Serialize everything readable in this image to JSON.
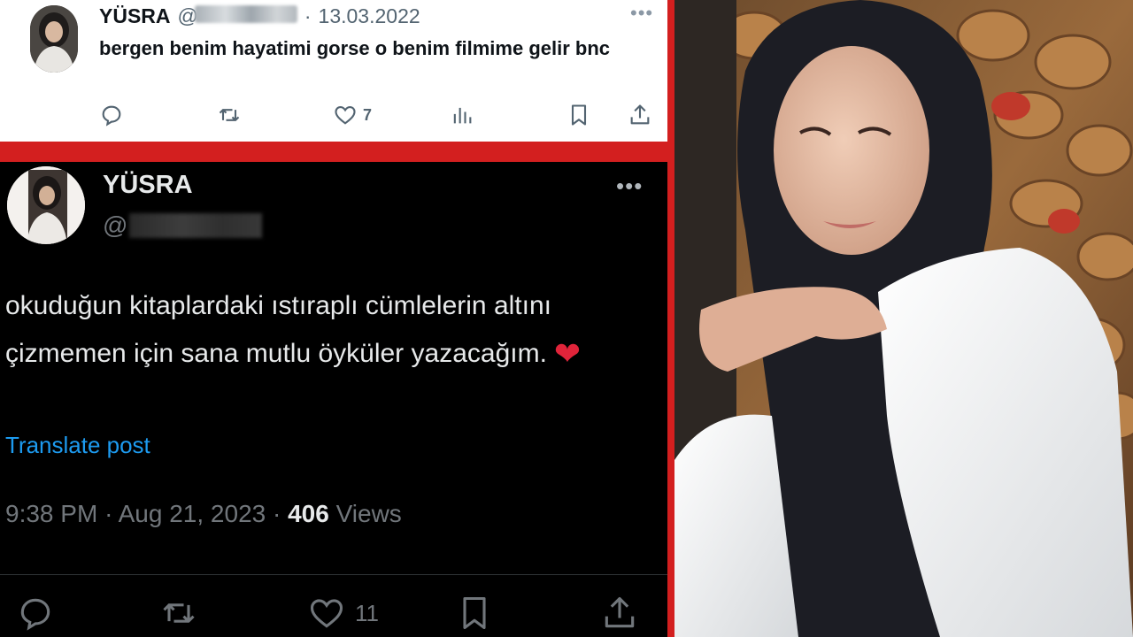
{
  "light_tweet": {
    "name": "YÜSRA",
    "handle_prefix": "@",
    "separator": "·",
    "date": "13.03.2022",
    "text": "bergen benim hayatimi gorse o benim filmime gelir bnc",
    "like_count": "7",
    "icons": [
      "reply-icon",
      "retweet-icon",
      "like-icon",
      "views-icon",
      "bookmark-icon",
      "share-icon"
    ]
  },
  "dark_tweet": {
    "name": "YÜSRA",
    "handle_prefix": "@",
    "text_before_heart": "okuduğun kitaplardaki ıstıraplı cümlelerin altını çizmemen için sana mutlu öyküler yazacağım.",
    "heart": "❤",
    "translate_label": "Translate post",
    "time": "9:38 PM",
    "separator": "·",
    "date": "Aug 21, 2023",
    "views_count": "406",
    "views_label": "Views",
    "like_count": "11",
    "icons": [
      "reply-icon",
      "retweet-icon",
      "like-icon",
      "bookmark-icon",
      "share-icon"
    ]
  },
  "colors": {
    "frame_red": "#d31f1f",
    "link_blue": "#1d9bf0",
    "heart_red": "#e0243a",
    "muted_gray": "#71767b"
  }
}
